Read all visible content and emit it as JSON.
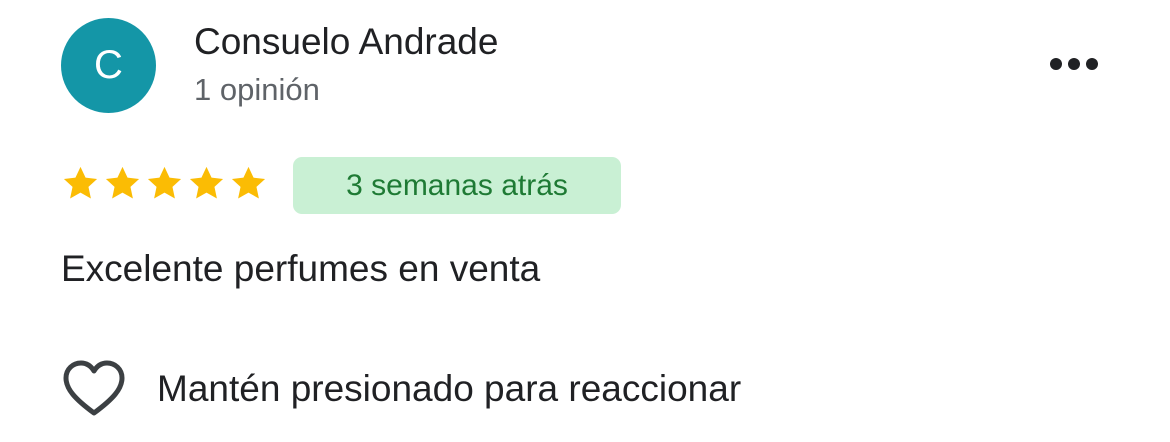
{
  "reviewer": {
    "initial": "C",
    "name": "Consuelo Andrade",
    "review_count": "1 opinión",
    "avatar_color": "#1496a7"
  },
  "review": {
    "rating": 5,
    "rating_max": 5,
    "star_color": "#fbbc04",
    "time_ago": "3 semanas atrás",
    "text": "Excelente perfumes en venta"
  },
  "actions": {
    "more_icon": "more-horizontal-icon",
    "react_icon": "heart-outline-icon",
    "react_label": "Mantén presionado para reaccionar"
  },
  "colors": {
    "badge_background": "#c9f0d4",
    "badge_text": "#1e7a34",
    "primary_text": "#202124",
    "secondary_text": "#5f6368"
  }
}
